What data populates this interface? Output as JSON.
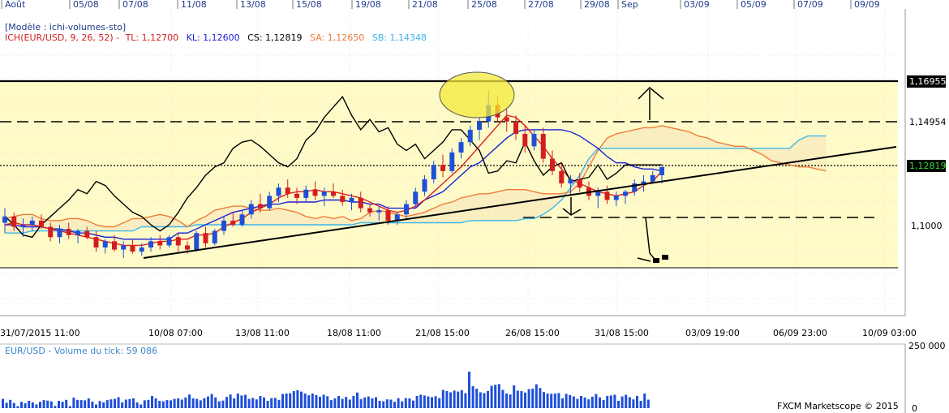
{
  "chart_data": {
    "type": "candlestick",
    "header": {
      "template": "[Modèle : ichi-volumes-sto]",
      "indicator_prefix": "ICH(EUR/USD, 9, 26, 52) -",
      "tl": "TL: 1,12700",
      "kl": "KL: 1,12600",
      "cs": "CS: 1,12819",
      "sa": "SA: 1,12650",
      "sb": "SB: 1,14348"
    },
    "top_axis": [
      "Août",
      "05/08",
      "07/08",
      "11/08",
      "13/08",
      "15/08",
      "19/08",
      "21/08",
      "25/08",
      "27/08",
      "29/08",
      "Sep",
      "03/09",
      "05/09",
      "07/09",
      "09/09"
    ],
    "bottom_axis": [
      "31/07/2015 11:00",
      "10/08 07:00",
      "13/08 11:00",
      "18/08 11:00",
      "21/08 15:00",
      "26/08 15:00",
      "31/08 15:00",
      "03/09 19:00",
      "06/09 23:00",
      "10/09 03:00"
    ],
    "y_labels": {
      "upper": "1,16955",
      "high": "1,14954",
      "last": "1,12819",
      "mid": "1,1000"
    },
    "y_values": {
      "upper": 1.16955,
      "high": 1.14954,
      "last": 1.12819,
      "mid": 1.1
    },
    "volume_title": "EUR/USD - Volume du tick: 59 086",
    "volume_axis": [
      "250 000",
      "0"
    ],
    "credit": "FXCM Marketscope © 2015",
    "colors": {
      "up": "#1f4fd8",
      "down": "#d21e1e",
      "tenkan": "#e02020",
      "kijun": "#1a22d8",
      "chikou": "#000000",
      "senkou_a": "#f07a3a",
      "senkou_b": "#3cb6ea",
      "band": "#fffbc8",
      "volume": "#1f4fd8"
    },
    "candles": [
      [
        1.101,
        1.108,
        1.096,
        1.104
      ],
      [
        1.104,
        1.106,
        1.097,
        1.099
      ],
      [
        1.099,
        1.103,
        1.094,
        1.1
      ],
      [
        1.1,
        1.104,
        1.097,
        1.102
      ],
      [
        1.102,
        1.105,
        1.098,
        1.099
      ],
      [
        1.099,
        1.101,
        1.092,
        1.094
      ],
      [
        1.094,
        1.1,
        1.091,
        1.098
      ],
      [
        1.098,
        1.101,
        1.093,
        1.095
      ],
      [
        1.095,
        1.098,
        1.091,
        1.097
      ],
      [
        1.097,
        1.099,
        1.093,
        1.094
      ],
      [
        1.094,
        1.097,
        1.087,
        1.089
      ],
      [
        1.089,
        1.093,
        1.086,
        1.092
      ],
      [
        1.092,
        1.095,
        1.087,
        1.088
      ],
      [
        1.088,
        1.092,
        1.084,
        1.09
      ],
      [
        1.09,
        1.093,
        1.086,
        1.087
      ],
      [
        1.087,
        1.091,
        1.085,
        1.089
      ],
      [
        1.089,
        1.094,
        1.087,
        1.092
      ],
      [
        1.092,
        1.095,
        1.088,
        1.09
      ],
      [
        1.09,
        1.095,
        1.089,
        1.094
      ],
      [
        1.094,
        1.096,
        1.087,
        1.09
      ],
      [
        1.09,
        1.092,
        1.086,
        1.088
      ],
      [
        1.088,
        1.097,
        1.087,
        1.096
      ],
      [
        1.096,
        1.099,
        1.089,
        1.091
      ],
      [
        1.091,
        1.098,
        1.09,
        1.097
      ],
      [
        1.097,
        1.104,
        1.095,
        1.102
      ],
      [
        1.102,
        1.106,
        1.099,
        1.1
      ],
      [
        1.1,
        1.107,
        1.099,
        1.105
      ],
      [
        1.105,
        1.112,
        1.103,
        1.11
      ],
      [
        1.11,
        1.115,
        1.106,
        1.108
      ],
      [
        1.108,
        1.116,
        1.107,
        1.114
      ],
      [
        1.114,
        1.12,
        1.111,
        1.118
      ],
      [
        1.118,
        1.122,
        1.113,
        1.115
      ],
      [
        1.115,
        1.118,
        1.11,
        1.113
      ],
      [
        1.113,
        1.119,
        1.111,
        1.117
      ],
      [
        1.117,
        1.121,
        1.112,
        1.114
      ],
      [
        1.114,
        1.118,
        1.109,
        1.116
      ],
      [
        1.116,
        1.12,
        1.113,
        1.114
      ],
      [
        1.114,
        1.117,
        1.109,
        1.111
      ],
      [
        1.111,
        1.115,
        1.107,
        1.113
      ],
      [
        1.113,
        1.116,
        1.106,
        1.108
      ],
      [
        1.108,
        1.11,
        1.104,
        1.106
      ],
      [
        1.106,
        1.109,
        1.102,
        1.107
      ],
      [
        1.107,
        1.109,
        1.1,
        1.102
      ],
      [
        1.102,
        1.106,
        1.1,
        1.105
      ],
      [
        1.105,
        1.112,
        1.103,
        1.11
      ],
      [
        1.11,
        1.118,
        1.108,
        1.116
      ],
      [
        1.116,
        1.124,
        1.114,
        1.122
      ],
      [
        1.122,
        1.131,
        1.12,
        1.129
      ],
      [
        1.129,
        1.134,
        1.123,
        1.126
      ],
      [
        1.126,
        1.137,
        1.125,
        1.135
      ],
      [
        1.135,
        1.142,
        1.132,
        1.14
      ],
      [
        1.14,
        1.148,
        1.138,
        1.146
      ],
      [
        1.146,
        1.152,
        1.141,
        1.15
      ],
      [
        1.15,
        1.165,
        1.147,
        1.158
      ],
      [
        1.158,
        1.162,
        1.15,
        1.152
      ],
      [
        1.152,
        1.156,
        1.145,
        1.15
      ],
      [
        1.15,
        1.153,
        1.141,
        1.144
      ],
      [
        1.144,
        1.148,
        1.135,
        1.138
      ],
      [
        1.138,
        1.146,
        1.136,
        1.144
      ],
      [
        1.144,
        1.147,
        1.13,
        1.132
      ],
      [
        1.132,
        1.136,
        1.124,
        1.126
      ],
      [
        1.126,
        1.13,
        1.118,
        1.12
      ],
      [
        1.12,
        1.124,
        1.114,
        1.122
      ],
      [
        1.122,
        1.125,
        1.116,
        1.118
      ],
      [
        1.118,
        1.121,
        1.112,
        1.114
      ],
      [
        1.114,
        1.118,
        1.108,
        1.116
      ],
      [
        1.116,
        1.119,
        1.11,
        1.112
      ],
      [
        1.112,
        1.116,
        1.109,
        1.114
      ],
      [
        1.114,
        1.117,
        1.11,
        1.116
      ],
      [
        1.116,
        1.122,
        1.114,
        1.12
      ],
      [
        1.12,
        1.124,
        1.116,
        1.121
      ],
      [
        1.121,
        1.126,
        1.12,
        1.124
      ],
      [
        1.124,
        1.127,
        1.12,
        1.128
      ]
    ],
    "tenkan_sen": [
      1.1,
      1.101,
      1.1,
      1.1,
      1.099,
      1.098,
      1.097,
      1.096,
      1.095,
      1.094,
      1.093,
      1.092,
      1.091,
      1.09,
      1.09,
      1.09,
      1.091,
      1.092,
      1.092,
      1.093,
      1.093,
      1.095,
      1.095,
      1.096,
      1.099,
      1.101,
      1.103,
      1.106,
      1.108,
      1.11,
      1.113,
      1.115,
      1.116,
      1.116,
      1.117,
      1.116,
      1.116,
      1.115,
      1.114,
      1.113,
      1.111,
      1.109,
      1.107,
      1.106,
      1.107,
      1.109,
      1.112,
      1.116,
      1.12,
      1.124,
      1.128,
      1.133,
      1.138,
      1.143,
      1.148,
      1.153,
      1.152,
      1.148,
      1.143,
      1.138,
      1.132,
      1.127,
      1.122,
      1.12,
      1.118,
      1.116,
      1.115,
      1.114,
      1.115,
      1.116,
      1.119,
      1.121,
      1.126
    ],
    "kijun_sen": [
      1.1,
      1.1,
      1.099,
      1.099,
      1.099,
      1.098,
      1.098,
      1.097,
      1.096,
      1.096,
      1.095,
      1.094,
      1.094,
      1.093,
      1.093,
      1.093,
      1.093,
      1.093,
      1.093,
      1.096,
      1.096,
      1.098,
      1.1,
      1.102,
      1.104,
      1.106,
      1.107,
      1.108,
      1.109,
      1.11,
      1.11,
      1.111,
      1.111,
      1.111,
      1.111,
      1.112,
      1.112,
      1.112,
      1.111,
      1.111,
      1.11,
      1.11,
      1.108,
      1.108,
      1.108,
      1.108,
      1.112,
      1.114,
      1.116,
      1.12,
      1.124,
      1.128,
      1.13,
      1.134,
      1.138,
      1.142,
      1.145,
      1.146,
      1.146,
      1.146,
      1.146,
      1.146,
      1.145,
      1.143,
      1.14,
      1.137,
      1.133,
      1.13,
      1.13,
      1.128,
      1.127,
      1.127,
      1.126
    ],
    "chikou_span": [
      1.104,
      1.1,
      1.095,
      1.094,
      1.1,
      1.104,
      1.108,
      1.112,
      1.117,
      1.115,
      1.121,
      1.119,
      1.114,
      1.11,
      1.106,
      1.104,
      1.1,
      1.097,
      1.1,
      1.106,
      1.113,
      1.118,
      1.124,
      1.128,
      1.13,
      1.137,
      1.14,
      1.141,
      1.138,
      1.134,
      1.13,
      1.128,
      1.132,
      1.141,
      1.145,
      1.152,
      1.157,
      1.162,
      1.153,
      1.146,
      1.151,
      1.145,
      1.147,
      1.139,
      1.136,
      1.139,
      1.132,
      1.136,
      1.14,
      1.146,
      1.146,
      1.141,
      1.136,
      1.125,
      1.126,
      1.131,
      1.13,
      1.14,
      1.131,
      1.124,
      1.128,
      1.13,
      1.121,
      1.122,
      1.123,
      1.129,
      1.122,
      1.125,
      1.129,
      1.129,
      1.129,
      1.129,
      1.129
    ],
    "senkou_span_a": [
      1.103,
      1.104,
      1.105,
      1.105,
      1.103,
      1.102,
      1.102,
      1.103,
      1.103,
      1.102,
      1.1,
      1.099,
      1.099,
      1.101,
      1.103,
      1.103,
      1.104,
      1.105,
      1.104,
      1.102,
      1.099,
      1.102,
      1.104,
      1.107,
      1.108,
      1.109,
      1.109,
      1.108,
      1.107,
      1.107,
      1.108,
      1.107,
      1.106,
      1.104,
      1.103,
      1.104,
      1.103,
      1.104,
      1.102,
      1.103,
      1.106,
      1.107,
      1.106,
      1.105,
      1.104,
      1.105,
      1.106,
      1.108,
      1.11,
      1.111,
      1.113,
      1.114,
      1.115,
      1.115,
      1.116,
      1.117,
      1.117,
      1.117,
      1.116,
      1.115,
      1.115,
      1.115,
      1.116,
      1.12,
      1.128,
      1.136,
      1.142,
      1.144,
      1.145,
      1.146,
      1.147,
      1.147,
      1.148,
      1.147,
      1.146,
      1.145,
      1.143,
      1.142,
      1.14,
      1.139,
      1.138,
      1.138,
      1.136,
      1.134,
      1.131,
      1.13,
      1.129,
      1.128,
      1.128,
      1.127,
      1.126
    ],
    "senkou_span_b": [
      1.096,
      1.096,
      1.096,
      1.097,
      1.097,
      1.097,
      1.097,
      1.097,
      1.097,
      1.097,
      1.097,
      1.097,
      1.097,
      1.097,
      1.097,
      1.099,
      1.099,
      1.099,
      1.099,
      1.099,
      1.099,
      1.1,
      1.1,
      1.1,
      1.1,
      1.1,
      1.1,
      1.1,
      1.1,
      1.1,
      1.1,
      1.1,
      1.1,
      1.1,
      1.1,
      1.1,
      1.1,
      1.1,
      1.1,
      1.101,
      1.101,
      1.101,
      1.101,
      1.101,
      1.101,
      1.101,
      1.101,
      1.101,
      1.101,
      1.101,
      1.101,
      1.102,
      1.102,
      1.102,
      1.102,
      1.102,
      1.102,
      1.103,
      1.103,
      1.105,
      1.108,
      1.112,
      1.118,
      1.124,
      1.132,
      1.137,
      1.137,
      1.137,
      1.137,
      1.137,
      1.137,
      1.137,
      1.137,
      1.137,
      1.137,
      1.137,
      1.137,
      1.137,
      1.137,
      1.137,
      1.137,
      1.137,
      1.137,
      1.137,
      1.137,
      1.137,
      1.137,
      1.141,
      1.143,
      1.143,
      1.143
    ],
    "volume": [
      38000,
      22000,
      34000,
      21000,
      8000,
      26000,
      20000,
      30000,
      24000,
      15000,
      26000,
      33000,
      31000,
      28000,
      9000,
      30000,
      26000,
      34000,
      8000,
      43000,
      34000,
      33000,
      32000,
      40000,
      27000,
      15000,
      29000,
      24000,
      33000,
      36000,
      38000,
      45000,
      24000,
      35000,
      37000,
      40000,
      24000,
      15000,
      32000,
      34000,
      50000,
      40000,
      30000,
      28000,
      33000,
      32000,
      38000,
      40000,
      35000,
      44000,
      56000,
      40000,
      38000,
      32000,
      41000,
      48000,
      58000,
      44000,
      28000,
      31000,
      46000,
      56000,
      40000,
      60000,
      52000,
      55000,
      38000,
      42000,
      36000,
      50000,
      44000,
      30000,
      41000,
      42000,
      34000,
      58000,
      60000,
      61000,
      70000,
      74000,
      68000,
      60000,
      53000,
      60000,
      54000,
      47000,
      55000,
      49000,
      33000,
      40000,
      50000,
      38000,
      46000,
      35000,
      50000,
      64000,
      37000,
      44000,
      48000,
      40000,
      45000,
      30000,
      28000,
      36000,
      35000,
      26000,
      41000,
      28000,
      41000,
      40000,
      31000,
      50000,
      55000,
      52000,
      48000,
      45000,
      49000,
      41000,
      75000,
      70000,
      65000,
      72000,
      68000,
      74000,
      61000,
      150000,
      90000,
      80000,
      65000,
      62000,
      70000,
      92000,
      96000,
      99000,
      75000,
      60000,
      56000,
      94000,
      72000,
      70000,
      64000,
      78000,
      80000,
      98000,
      83000,
      66000,
      60000,
      59000,
      60000,
      62000,
      40000,
      59000,
      54000,
      48000,
      38000,
      50000,
      44000,
      36000,
      47000,
      58000,
      44000,
      33000,
      50000,
      52000,
      55000,
      30000,
      48000,
      55000,
      45000,
      36000,
      50000,
      30000,
      60000,
      35000
    ]
  }
}
